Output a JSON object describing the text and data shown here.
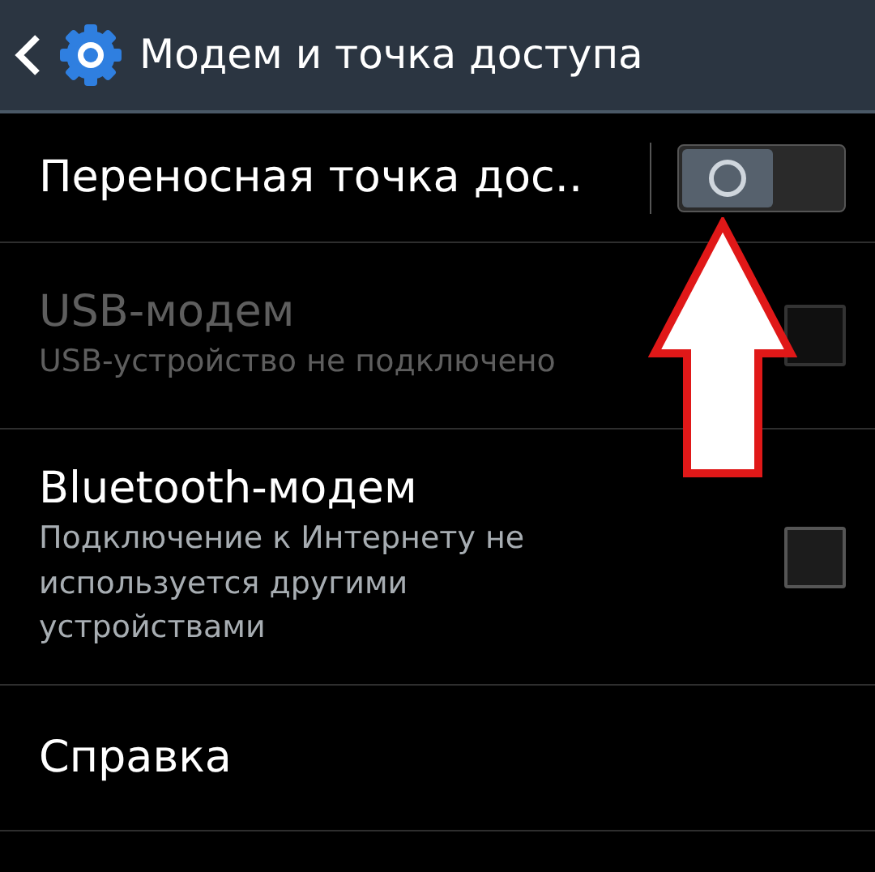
{
  "header": {
    "title": "Модем и точка доступа"
  },
  "items": [
    {
      "kind": "switch",
      "title": "Переносная точка дос..",
      "on": false,
      "disabled": false
    },
    {
      "kind": "checkbox",
      "title": "USB-модем",
      "subtitle": "USB-устройство не подключено",
      "checked": false,
      "disabled": true
    },
    {
      "kind": "checkbox",
      "title": "Bluetooth-модем",
      "subtitle": "Подключение к Интернету не используется другими устройствами",
      "checked": false,
      "disabled": false
    },
    {
      "kind": "plain",
      "title": "Справка",
      "disabled": false
    }
  ]
}
